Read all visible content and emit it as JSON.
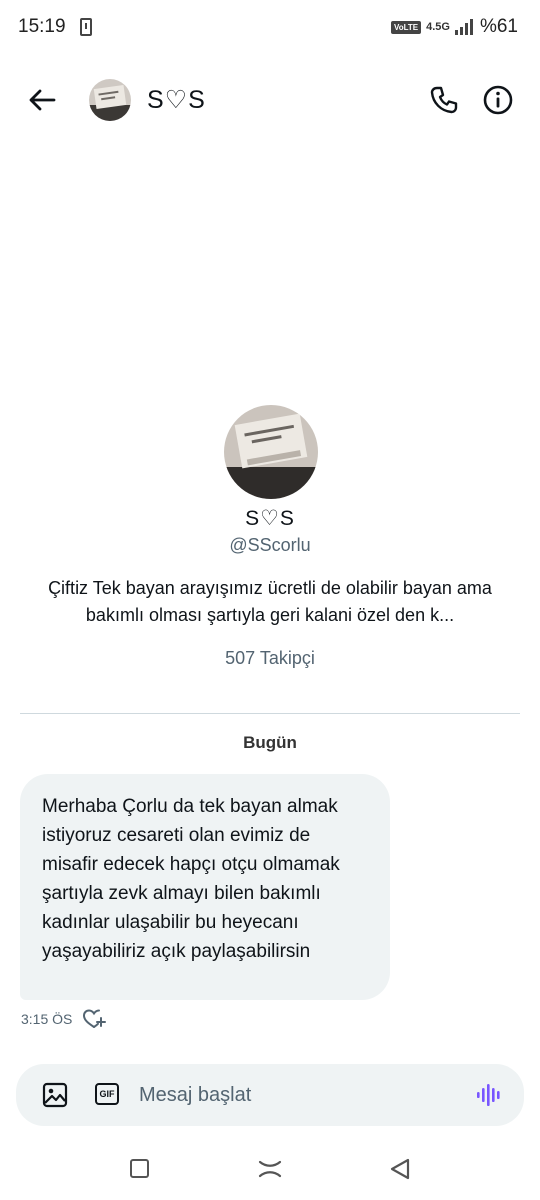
{
  "status": {
    "time": "15:19",
    "volte": "VoLTE",
    "network": "4.5G",
    "battery": "%61"
  },
  "header": {
    "name": "S♡S"
  },
  "profile": {
    "name": "S♡S",
    "handle": "@SScorlu",
    "bio": "Çiftiz Tek bayan arayışımız ücretli de olabilir bayan ama bakımlı olması şartıyla geri kalani özel den k...",
    "followers": "507 Takipçi"
  },
  "conversation": {
    "date": "Bugün",
    "messages": [
      {
        "text": "Merhaba Çorlu da tek bayan almak istiyoruz cesareti olan evimiz de misafir edecek hapçı otçu olmamak şartıyla zevk almayı bilen bakımlı kadınlar ulaşabilir bu heyecanı yaşayabiliriz açık paylaşabilirsin",
        "time": "3:15 ÖS"
      }
    ]
  },
  "composer": {
    "placeholder": "Mesaj başlat",
    "gif_label": "GIF"
  },
  "colors": {
    "text": "#0f1419",
    "secondary": "#536471",
    "bubble": "#eff3f4",
    "voice_accent": "#7856ff"
  }
}
